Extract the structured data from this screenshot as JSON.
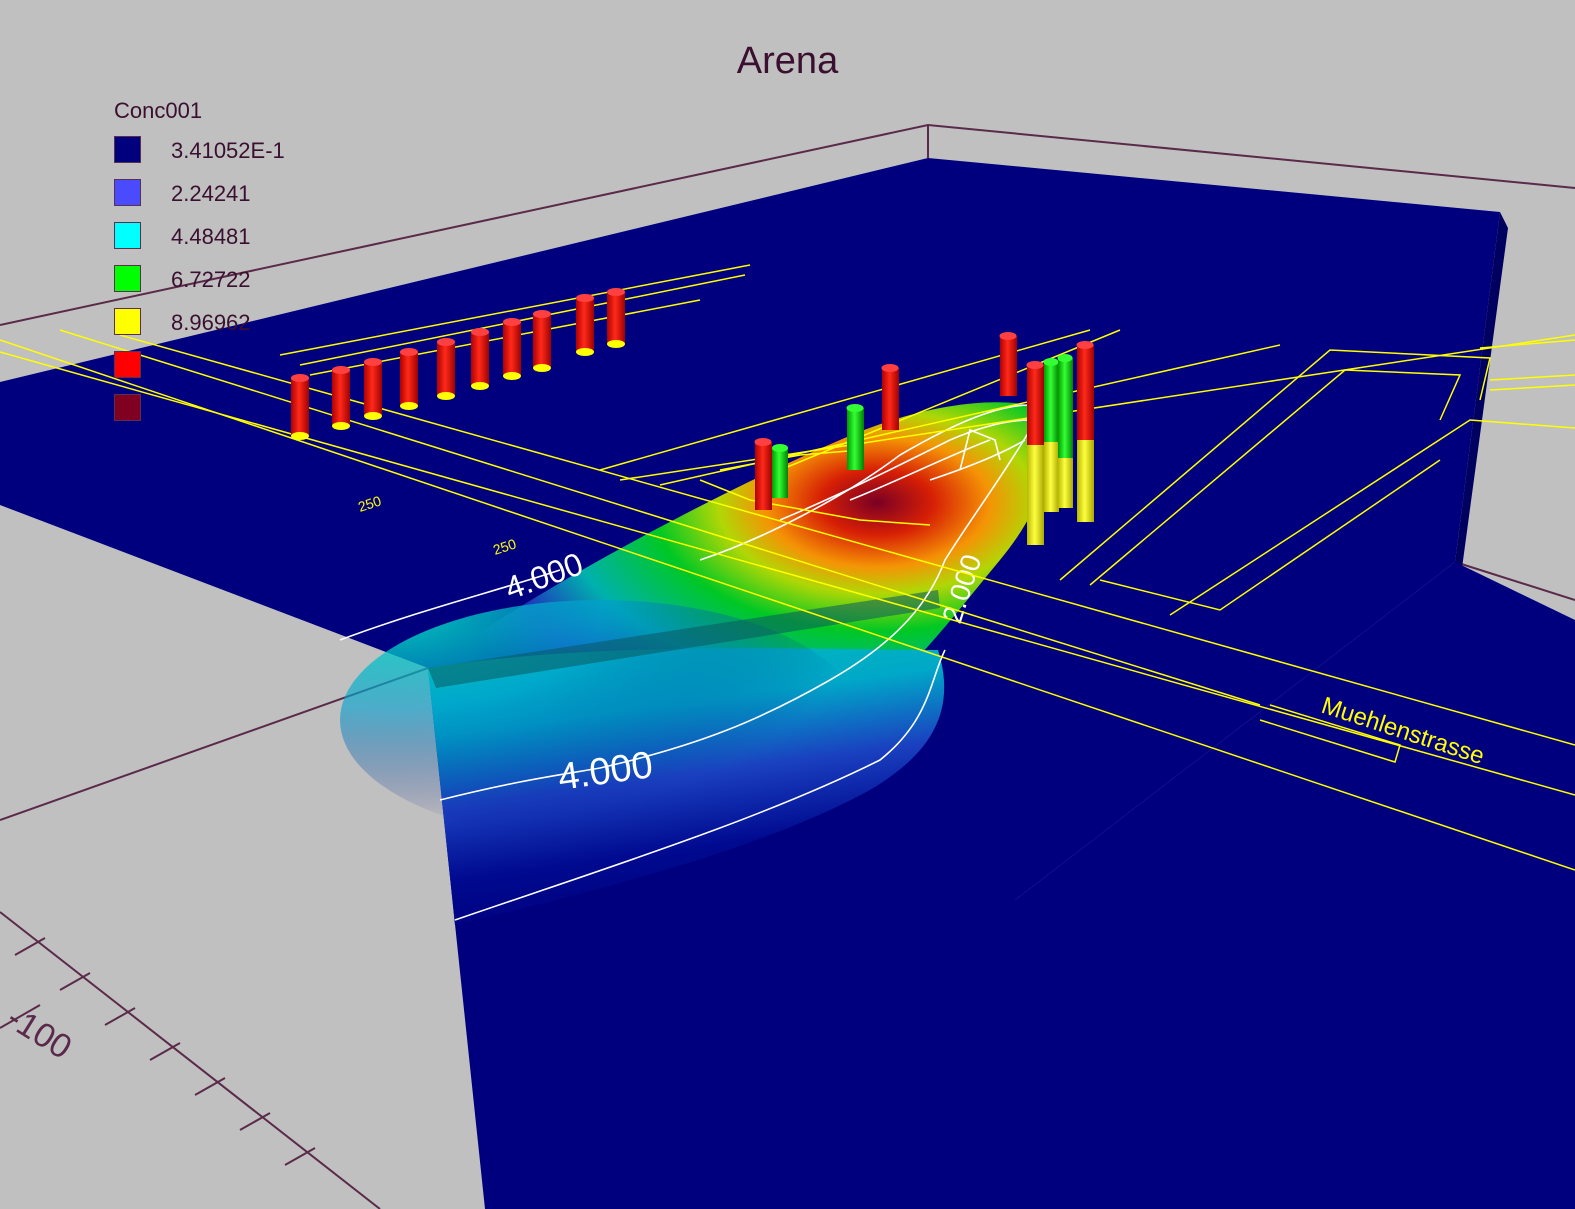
{
  "title": "Arena",
  "legend": {
    "title": "Conc001",
    "items": [
      {
        "label": "3.41052E-1",
        "color": "#00007f"
      },
      {
        "label": "2.24241",
        "color": "#4a4aff"
      },
      {
        "label": "4.48481",
        "color": "#00ffff"
      },
      {
        "label": "6.72722",
        "color": "#00ff00"
      },
      {
        "label": "8.96962",
        "color": "#ffff00"
      },
      {
        "label": "",
        "color": "#ff0000"
      },
      {
        "label": "",
        "color": "#7f0020"
      }
    ]
  },
  "contour_labels": [
    "4.000",
    "4.000",
    "2.000"
  ],
  "axis_labels": [
    "-100",
    "250",
    "250"
  ],
  "street_label": "Muehlenstrasse",
  "colors": {
    "background": "#c0c0c0",
    "model_body": "#00007f",
    "map_lines": "#ffff00",
    "contour_lines": "#ffffff",
    "axis_lines": "#5a2a4a"
  }
}
